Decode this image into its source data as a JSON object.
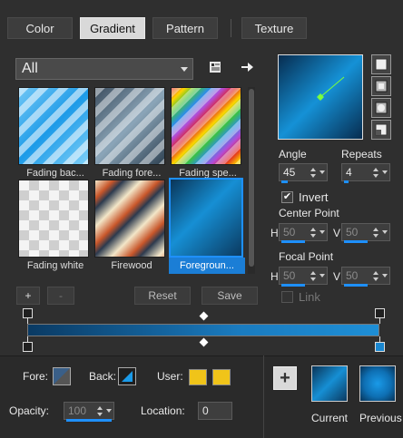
{
  "tabs": [
    {
      "label": "Color"
    },
    {
      "label": "Gradient"
    },
    {
      "label": "Pattern"
    },
    {
      "label": "Texture"
    }
  ],
  "category": {
    "selected": "All"
  },
  "swatches": [
    {
      "label": "Fading bac..."
    },
    {
      "label": "Fading fore..."
    },
    {
      "label": "Fading spe..."
    },
    {
      "label": "Fading white"
    },
    {
      "label": "Firewood"
    },
    {
      "label": "Foregroun..."
    }
  ],
  "library_buttons": {
    "add": "+",
    "remove": "-",
    "reset": "Reset",
    "save": "Save"
  },
  "angle": {
    "label": "Angle",
    "value": "45"
  },
  "repeats": {
    "label": "Repeats",
    "value": "4"
  },
  "invert": {
    "label": "Invert",
    "checked": true
  },
  "center_point": {
    "label": "Center Point",
    "h_label": "H",
    "h_value": "50",
    "v_label": "V",
    "v_value": "50"
  },
  "focal_point": {
    "label": "Focal Point",
    "h_label": "H",
    "h_value": "50",
    "v_label": "V",
    "v_value": "50"
  },
  "link": {
    "label": "Link",
    "checked": false
  },
  "bottom": {
    "fore_label": "Fore:",
    "back_label": "Back:",
    "user_label": "User:",
    "opacity_label": "Opacity:",
    "opacity_value": "100",
    "location_label": "Location:",
    "location_value": "0",
    "add_button": "+",
    "current_label": "Current",
    "previous_label": "Previous"
  },
  "colors": {
    "accent": "#1e90ff",
    "user_color_1": "#f0c419",
    "user_color_2": "#f0c419"
  }
}
